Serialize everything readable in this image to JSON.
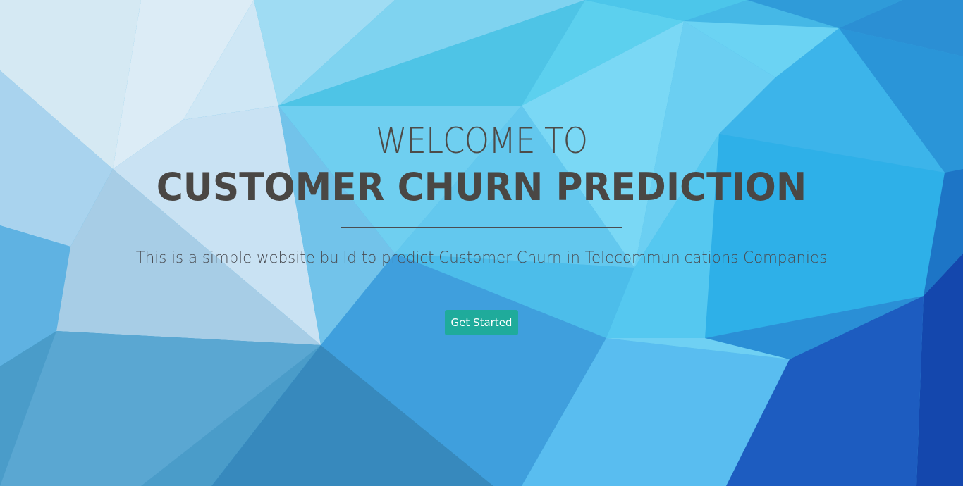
{
  "hero": {
    "welcome": "WELCOME TO",
    "title": "CUSTOMER CHURN PREDICTION",
    "subtitle": "This is a simple website build to predict Customer Churn in Telecommunications Companies",
    "cta_label": "Get Started"
  },
  "colors": {
    "heading": "#4a4744",
    "button": "#1fab9b",
    "button_text": "#ffffff",
    "background_accent": "#3aa8e0"
  }
}
